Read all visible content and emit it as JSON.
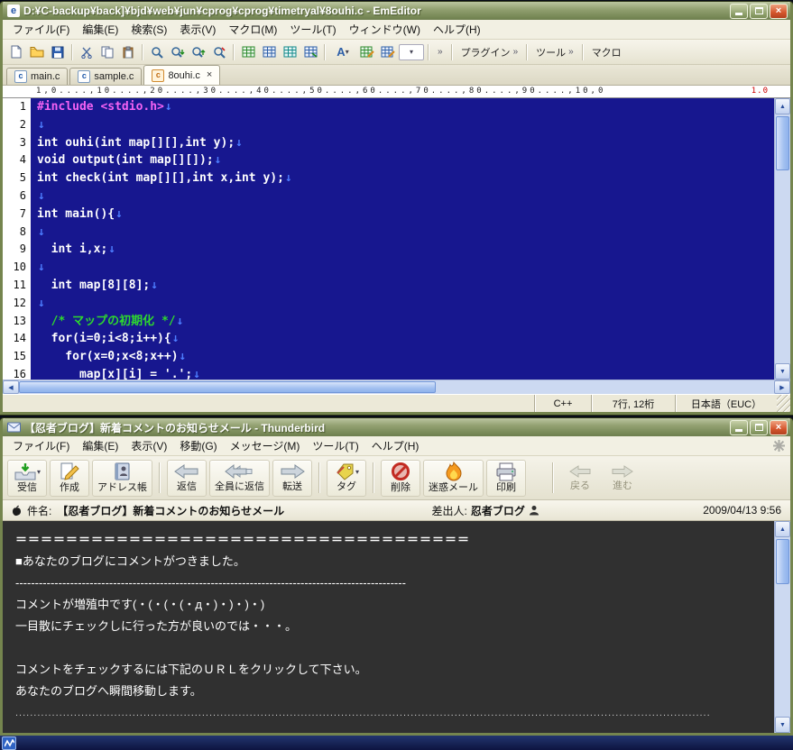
{
  "emeditor": {
    "title": "D:¥C-backup¥back]¥bjd¥web¥jun¥cprog¥cprog¥timetryal¥8ouhi.c - EmEditor",
    "menu": [
      "ファイル(F)",
      "編集(E)",
      "検索(S)",
      "表示(V)",
      "マクロ(M)",
      "ツール(T)",
      "ウィンドウ(W)",
      "ヘルプ(H)"
    ],
    "toolbar": {
      "plugins_label": "プラグイン",
      "tools_label": "ツール",
      "macro_label": "マクロ"
    },
    "tabs": [
      {
        "label": "main.c",
        "active": false
      },
      {
        "label": "sample.c",
        "active": false
      },
      {
        "label": "8ouhi.c",
        "active": true
      }
    ],
    "ruler": {
      "text": "1,0....,10....,20....,30....,40....,50....,60....,70....,80....,90....,10,0",
      "marker": "1.0"
    },
    "code": {
      "newline_mark": "↓",
      "lines": [
        {
          "n": "1",
          "arrow": true,
          "parts": [
            [
              "pp",
              "#include <stdio.h>"
            ]
          ]
        },
        {
          "n": "2",
          "arrow": true,
          "parts": []
        },
        {
          "n": "3",
          "arrow": true,
          "parts": [
            [
              "pl",
              "int ouhi(int map[][],int y);"
            ]
          ]
        },
        {
          "n": "4",
          "arrow": true,
          "parts": [
            [
              "pl",
              "void output(int map[][]);"
            ]
          ]
        },
        {
          "n": "5",
          "arrow": true,
          "parts": [
            [
              "pl",
              "int check(int map[][],int x,int y);"
            ]
          ]
        },
        {
          "n": "6",
          "arrow": true,
          "parts": []
        },
        {
          "n": "7",
          "arrow": true,
          "parts": [
            [
              "pl",
              "int main(){"
            ]
          ]
        },
        {
          "n": "8",
          "arrow": true,
          "parts": []
        },
        {
          "n": "9",
          "arrow": true,
          "parts": [
            [
              "pl",
              "  int i,x;"
            ]
          ]
        },
        {
          "n": "10",
          "arrow": true,
          "parts": []
        },
        {
          "n": "11",
          "arrow": true,
          "parts": [
            [
              "pl",
              "  int map[8][8];"
            ]
          ]
        },
        {
          "n": "12",
          "arrow": true,
          "parts": []
        },
        {
          "n": "13",
          "arrow": true,
          "parts": [
            [
              "pl",
              "  "
            ],
            [
              "cmt",
              "/* マップの初期化 */"
            ]
          ]
        },
        {
          "n": "14",
          "arrow": true,
          "parts": [
            [
              "pl",
              "  for(i=0;i<8;i++){"
            ]
          ]
        },
        {
          "n": "15",
          "arrow": true,
          "parts": [
            [
              "pl",
              "    for(x=0;x<8;x++)"
            ]
          ]
        },
        {
          "n": "16",
          "arrow": true,
          "parts": [
            [
              "pl",
              "      map[x][i] = '.';"
            ]
          ]
        }
      ]
    },
    "status": {
      "syntax": "C++",
      "position": "7行, 12桁",
      "encoding": "日本語（EUC）"
    }
  },
  "thunderbird": {
    "title": "【忍者ブログ】新着コメントのお知らせメール - Thunderbird",
    "menu": [
      "ファイル(F)",
      "編集(E)",
      "表示(V)",
      "移動(G)",
      "メッセージ(M)",
      "ツール(T)",
      "ヘルプ(H)"
    ],
    "toolbar": {
      "get_mail": "受信",
      "compose": "作成",
      "address_book": "アドレス帳",
      "reply": "返信",
      "reply_all": "全員に返信",
      "forward": "転送",
      "tag": "タグ",
      "delete": "削除",
      "junk": "迷惑メール",
      "print": "印刷",
      "back": "戻る",
      "go_forward": "進む"
    },
    "header": {
      "subject_label": "件名:",
      "subject": "【忍者ブログ】新着コメントのお知らせメール",
      "from_label": "差出人:",
      "from": "忍者ブログ",
      "date": "2009/04/13 9:56"
    },
    "body_lines": [
      {
        "text": "＝＝＝＝＝＝＝＝＝＝＝＝＝＝＝＝＝＝＝＝＝＝＝＝＝＝＝＝＝＝＝＝＝＝＝＝",
        "style": "strong"
      },
      {
        "text": "■あなたのブログにコメントがつきました。",
        "style": "normal"
      },
      {
        "text": "----------------------------------------------------------------------------------------------------",
        "style": "normal"
      },
      {
        "text": "コメントが増殖中です(・(・(・(・д・)・)・)・)",
        "style": "normal"
      },
      {
        "text": "一目散にチェックしに行った方が良いのでは・・・。",
        "style": "normal"
      },
      {
        "text": "",
        "style": "normal"
      },
      {
        "text": "コメントをチェックするには下記のＵＲＬをクリックして下さい。",
        "style": "normal"
      },
      {
        "text": "あなたのブログへ瞬間移動します。",
        "style": "normal"
      },
      {
        "text": "..............................................................................................................................................................................................",
        "style": "dim"
      }
    ]
  }
}
